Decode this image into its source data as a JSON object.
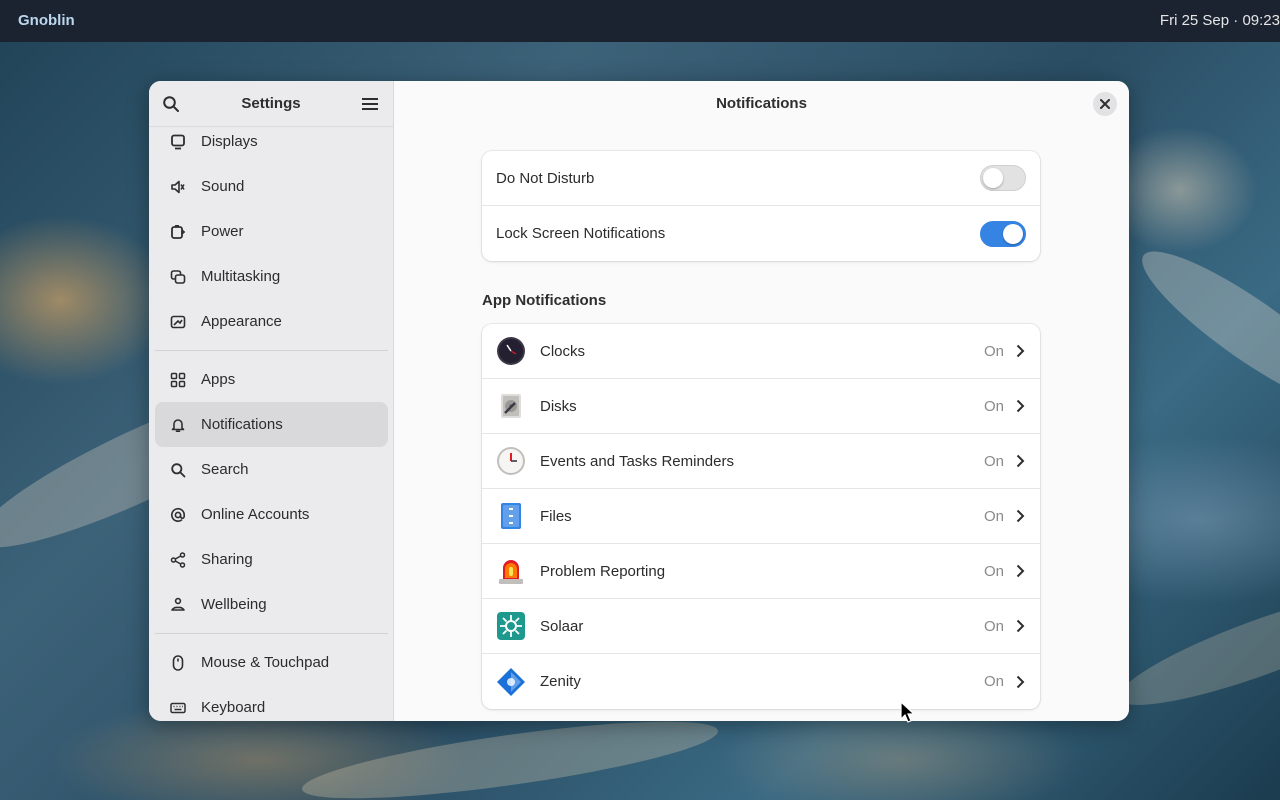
{
  "topbar": {
    "brand": "Gnoblin",
    "clock": "Fri 25 Sep  ·  09:23"
  },
  "window": {
    "sidebar": {
      "title": "Settings",
      "groups": [
        [
          {
            "label": "Displays",
            "icon": "display-icon"
          },
          {
            "label": "Sound",
            "icon": "speaker-icon"
          },
          {
            "label": "Power",
            "icon": "battery-icon"
          },
          {
            "label": "Multitasking",
            "icon": "multitasking-icon"
          },
          {
            "label": "Appearance",
            "icon": "appearance-icon"
          }
        ],
        [
          {
            "label": "Apps",
            "icon": "apps-grid-icon"
          },
          {
            "label": "Notifications",
            "icon": "bell-icon",
            "active": true
          },
          {
            "label": "Search",
            "icon": "search-icon"
          },
          {
            "label": "Online Accounts",
            "icon": "at-sign-icon"
          },
          {
            "label": "Sharing",
            "icon": "share-icon"
          },
          {
            "label": "Wellbeing",
            "icon": "wellbeing-icon"
          }
        ],
        [
          {
            "label": "Mouse & Touchpad",
            "icon": "mouse-icon"
          },
          {
            "label": "Keyboard",
            "icon": "keyboard-icon"
          }
        ]
      ]
    },
    "content": {
      "title": "Notifications",
      "general": [
        {
          "label": "Do Not Disturb",
          "enabled": false
        },
        {
          "label": "Lock Screen Notifications",
          "enabled": true
        }
      ],
      "app_section_title": "App Notifications",
      "apps": [
        {
          "name": "Clocks",
          "status": "On",
          "icon": "clock-app-icon"
        },
        {
          "name": "Disks",
          "status": "On",
          "icon": "disks-app-icon"
        },
        {
          "name": "Events and Tasks Reminders",
          "status": "On",
          "icon": "reminders-app-icon"
        },
        {
          "name": "Files",
          "status": "On",
          "icon": "files-app-icon"
        },
        {
          "name": "Problem Reporting",
          "status": "On",
          "icon": "alarm-siren-app-icon"
        },
        {
          "name": "Solaar",
          "status": "On",
          "icon": "solaar-app-icon"
        },
        {
          "name": "Zenity",
          "status": "On",
          "icon": "zenity-app-icon"
        }
      ]
    }
  },
  "colors": {
    "accent": "#3584e4",
    "topbar": "#1c2330",
    "sidebar": "#ebebed",
    "active_item": "#d9d9db"
  }
}
